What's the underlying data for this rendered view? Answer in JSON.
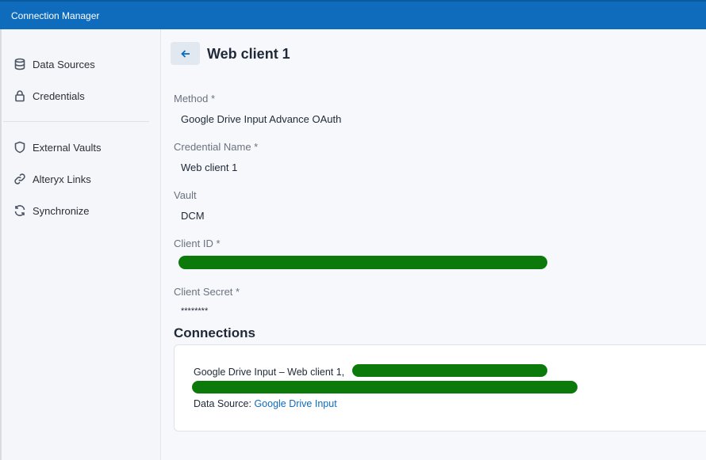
{
  "titlebar": {
    "title": "Connection Manager"
  },
  "sidebar": {
    "items": [
      {
        "label": "Data Sources",
        "icon": "database-icon"
      },
      {
        "label": "Credentials",
        "icon": "lock-icon"
      },
      {
        "label": "External Vaults",
        "icon": "shield-icon"
      },
      {
        "label": "Alteryx Links",
        "icon": "link-icon"
      },
      {
        "label": "Synchronize",
        "icon": "sync-icon"
      }
    ]
  },
  "main": {
    "title": "Web client 1",
    "fields": {
      "method": {
        "label": "Method *",
        "value": "Google Drive Input Advance OAuth"
      },
      "credential_name": {
        "label": "Credential Name *",
        "value": "Web client 1"
      },
      "vault": {
        "label": "Vault",
        "value": "DCM"
      },
      "client_id": {
        "label": "Client ID *"
      },
      "client_secret": {
        "label": "Client Secret *",
        "value": "********"
      }
    },
    "connections": {
      "title": "Connections",
      "items": [
        {
          "name": "Google Drive Input – Web client 1,",
          "source_prefix": "Data Source: ",
          "source_link": "Google Drive Input"
        }
      ]
    }
  },
  "colors": {
    "accent": "#0f6cbd",
    "redaction": "#0b7a0b"
  }
}
